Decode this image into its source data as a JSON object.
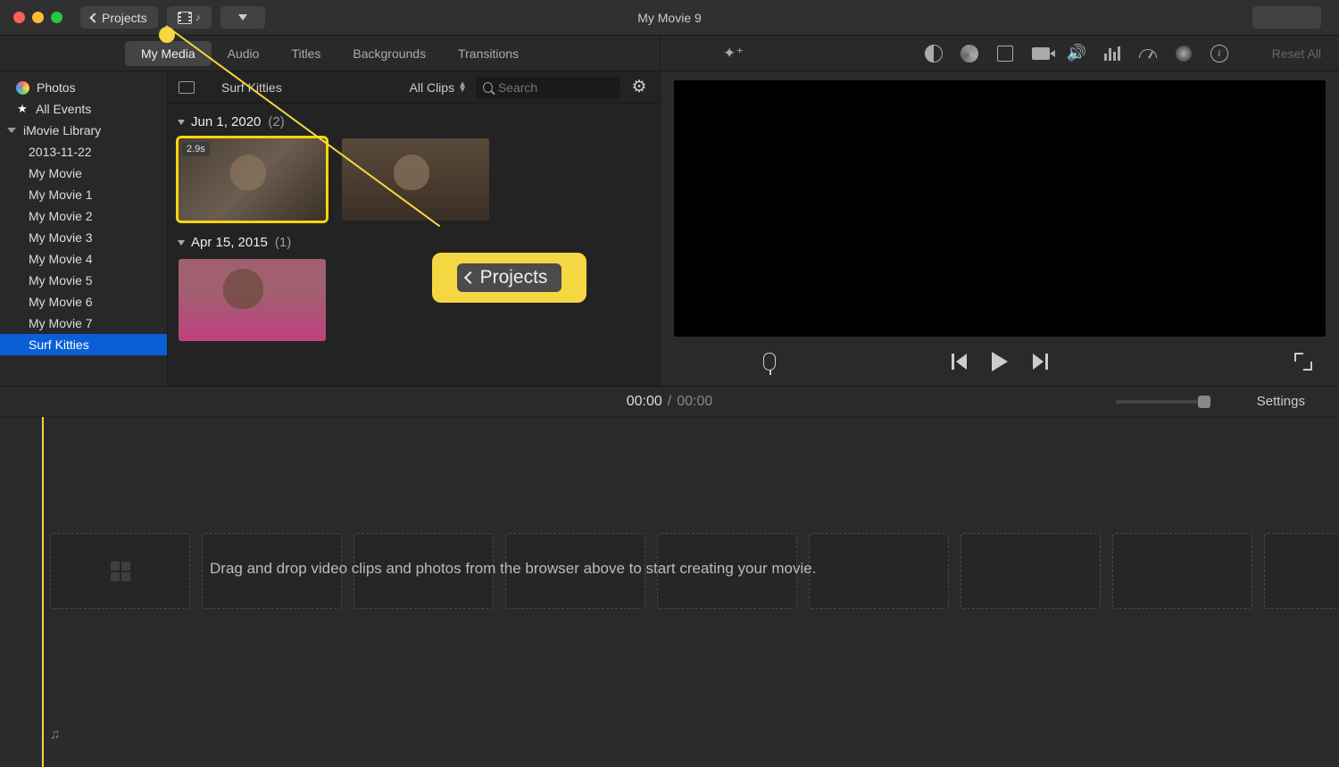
{
  "window": {
    "title": "My Movie 9"
  },
  "titlebar": {
    "projects_label": "Projects"
  },
  "tabs": {
    "my_media": "My Media",
    "audio": "Audio",
    "titles": "Titles",
    "backgrounds": "Backgrounds",
    "transitions": "Transitions"
  },
  "sidebar": {
    "photos": "Photos",
    "all_events": "All Events",
    "library": "iMovie Library",
    "items": [
      "2013-11-22",
      "My Movie",
      "My Movie 1",
      "My Movie 2",
      "My Movie 3",
      "My Movie 4",
      "My Movie 5",
      "My Movie 6",
      "My Movie 7",
      "Surf Kitties"
    ]
  },
  "clips_header": {
    "breadcrumb": "Surf Kitties",
    "filter": "All Clips",
    "search_placeholder": "Search"
  },
  "clip_groups": [
    {
      "date": "Jun 1, 2020",
      "count": "(2)",
      "thumbs": [
        {
          "duration": "2.9s"
        },
        {}
      ]
    },
    {
      "date": "Apr 15, 2015",
      "count": "(1)",
      "thumbs": [
        {}
      ]
    }
  ],
  "viewer": {
    "reset_all": "Reset All"
  },
  "timeline": {
    "current": "00:00",
    "separator": "/",
    "total": "00:00",
    "settings": "Settings",
    "hint": "Drag and drop video clips and photos from the browser above to start creating your movie."
  },
  "annotation": {
    "projects_label": "Projects"
  }
}
